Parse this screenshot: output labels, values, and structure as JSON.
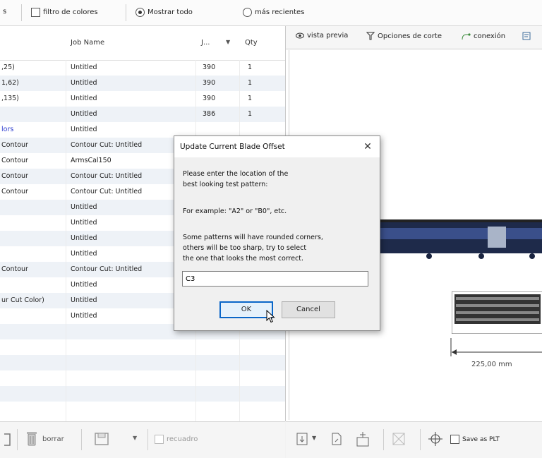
{
  "toolbar": {
    "left_fragment": "s",
    "color_filter_label": "filtro de colores",
    "show_all_label": "Mostrar todo",
    "recent_label": "más recientes"
  },
  "job_list": {
    "columns": {
      "job_name": "Job Name",
      "j": "J...",
      "qty": "Qty"
    },
    "rows": [
      {
        "name": ",25)",
        "job": "Untitled",
        "j": "390",
        "qty": "1",
        "blue": false
      },
      {
        "name": "1,62)",
        "job": "Untitled",
        "j": "390",
        "qty": "1",
        "blue": false
      },
      {
        "name": ",135)",
        "job": "Untitled",
        "j": "390",
        "qty": "1",
        "blue": false
      },
      {
        "name": "",
        "job": "Untitled",
        "j": "386",
        "qty": "1",
        "blue": false
      },
      {
        "name": "lors",
        "job": "Untitled",
        "j": "",
        "qty": "",
        "blue": true
      },
      {
        "name": "Contour",
        "job": "Contour Cut: Untitled",
        "j": "",
        "qty": "",
        "blue": false
      },
      {
        "name": "Contour",
        "job": "ArmsCal150",
        "j": "",
        "qty": "",
        "blue": false
      },
      {
        "name": "Contour",
        "job": "Contour Cut: Untitled",
        "j": "",
        "qty": "",
        "blue": false
      },
      {
        "name": "Contour",
        "job": "Contour Cut: Untitled",
        "j": "",
        "qty": "",
        "blue": false
      },
      {
        "name": "",
        "job": "Untitled",
        "j": "",
        "qty": "",
        "blue": false
      },
      {
        "name": "",
        "job": "Untitled",
        "j": "",
        "qty": "",
        "blue": false
      },
      {
        "name": "",
        "job": "Untitled",
        "j": "",
        "qty": "",
        "blue": false
      },
      {
        "name": "",
        "job": "Untitled",
        "j": "",
        "qty": "",
        "blue": false
      },
      {
        "name": "Contour",
        "job": "Contour Cut: Untitled",
        "j": "",
        "qty": "",
        "blue": false
      },
      {
        "name": "",
        "job": "Untitled",
        "j": "",
        "qty": "",
        "blue": false
      },
      {
        "name": "ur Cut Color)",
        "job": "Untitled",
        "j": "",
        "qty": "",
        "blue": false
      },
      {
        "name": "",
        "job": "Untitled",
        "j": "",
        "qty": "",
        "blue": false
      }
    ]
  },
  "left_bottom": {
    "delete_label": "borrar",
    "crop_label": "recuadro"
  },
  "right_panel": {
    "tabs": [
      "vista previa",
      "Opciones de corte",
      "conexión"
    ],
    "dimension_label": "225,00 mm",
    "save_plt_label": "Save as PLT"
  },
  "dialog": {
    "title": "Update Current Blade Offset",
    "lines": [
      "Please enter the location of the",
      "best looking test pattern:",
      "For example:  \"A2\" or \"B0\", etc.",
      "Some patterns will have rounded corners,",
      "others will be too sharp, try to select",
      "the one that looks the most correct."
    ],
    "input_value": "C3",
    "ok_label": "OK",
    "cancel_label": "Cancel"
  },
  "colors": {
    "accent": "#0a66c8",
    "row_alt": "#eef2f7",
    "link_blue": "#2c3ccf"
  }
}
